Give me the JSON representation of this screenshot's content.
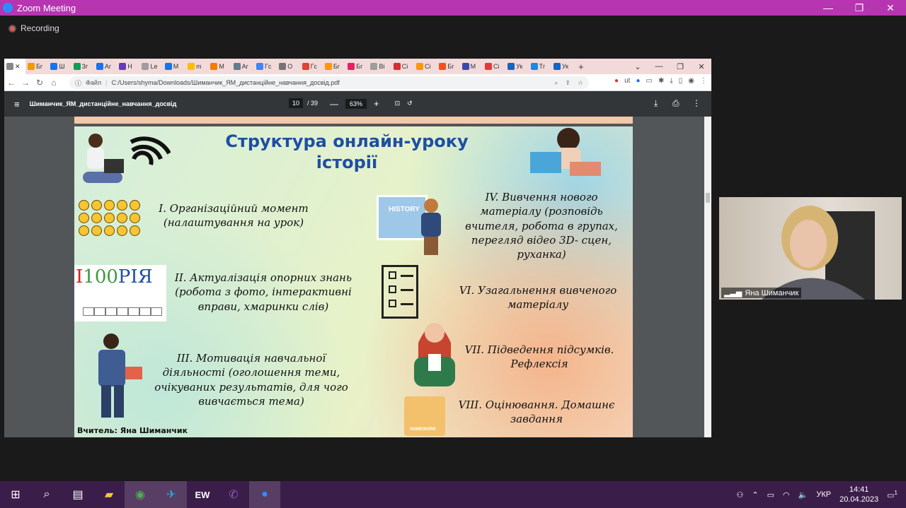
{
  "zoom": {
    "title": "Zoom Meeting",
    "recording": "Recording",
    "participant_name": "Яна Шиманчик"
  },
  "browser": {
    "tabs": [
      "Бг",
      "Ш",
      "Зг",
      "Аг",
      "Н",
      "Le",
      "М",
      "m",
      "М",
      "Аг",
      "Гс",
      "О",
      "Гс",
      "Бг",
      "Бг",
      "Bi",
      "Ci",
      "Ci",
      "Бг",
      "М",
      "Ci",
      "Ук",
      "Тг",
      "Ук"
    ],
    "addr_label": "Файл",
    "url": "C:/Users/shyma/Downloads/Шиманчик_ЯМ_дистанційне_навчання_досвід.pdf",
    "pdf": {
      "filename": "Шиманчик_ЯМ_дистанційне_навчання_досвід",
      "page_current": "10",
      "page_total": "/ 39",
      "zoom": "63%"
    }
  },
  "slide": {
    "title_line1": "Структура онлайн-уроку",
    "title_line2": "історії",
    "item1": "І. Організаційний момент (налаштування на урок)",
    "item2": "ІІ. Актуалізація опорних знань (робота з фото, інтерактивні вправи, хмаринки слів)",
    "item3": "ІІІ. Мотивація навчальної діяльності (оголошення теми, очікуваних результатів, для чого вивчається тема)",
    "item4": "IV. Вивчення нового матеріалу (розповідь вчителя, робота в групах, перегляд відео 3D- сцен, руханка)",
    "item6": "VI. Узагальнення вивченого матеріалу",
    "item7": "VII. Підведення підсумків. Рефлексія",
    "item8": "VIII. Оцінювання. Домашнє завдання",
    "teacher": "Вчитель: Яна Шиманчик",
    "history_board": "HISTORY",
    "homework_label": "HOMEWORK",
    "istoria_logo": {
      "i": "І",
      "digits": "100",
      "rest": "РІЯ"
    }
  },
  "taskbar": {
    "lang": "УКР",
    "time": "14:41",
    "date": "20.04.2023",
    "notif_count": "1"
  },
  "colors": {
    "zoom_title_bar": "#b735b1",
    "taskbar": "#3b1d4a",
    "slide_title": "#1d4fa3"
  }
}
